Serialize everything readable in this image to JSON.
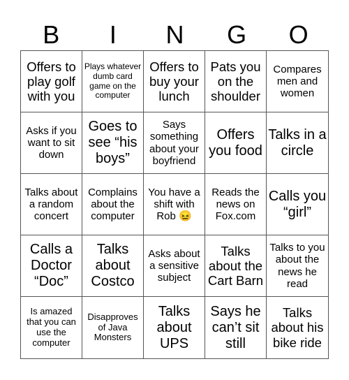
{
  "header": [
    "B",
    "I",
    "N",
    "G",
    "O"
  ],
  "cells": [
    {
      "text": "Offers to play golf with you",
      "size": "s-l"
    },
    {
      "text": "Plays whatever dumb card game on the computer",
      "size": "s-xs"
    },
    {
      "text": "Offers to buy your lunch",
      "size": "s-l"
    },
    {
      "text": "Pats you on the shoulder",
      "size": "s-l"
    },
    {
      "text": "Compares men and women",
      "size": "s-m"
    },
    {
      "text": "Asks if you want to sit down",
      "size": "s-m"
    },
    {
      "text": "Goes to see “his boys”",
      "size": "s-xl"
    },
    {
      "text": "Says something about your boyfriend",
      "size": "s-m"
    },
    {
      "text": "Offers you food",
      "size": "s-xl"
    },
    {
      "text": "Talks in a circle",
      "size": "s-xl"
    },
    {
      "text": "Talks about a random concert",
      "size": "s-m"
    },
    {
      "text": "Complains about the computer",
      "size": "s-m"
    },
    {
      "text": "You have a shift with Rob 😖",
      "size": "s-m"
    },
    {
      "text": "Reads the news on Fox.com",
      "size": "s-m"
    },
    {
      "text": "Calls you “girl”",
      "size": "s-xl"
    },
    {
      "text": "Calls a Doctor “Doc”",
      "size": "s-xl"
    },
    {
      "text": "Talks about Costco",
      "size": "s-xl"
    },
    {
      "text": "Asks about a sensitive subject",
      "size": "s-m"
    },
    {
      "text": "Talks about the Cart Barn",
      "size": "s-l"
    },
    {
      "text": "Talks to you about the news he read",
      "size": "s-m"
    },
    {
      "text": "Is amazed that you can use the computer",
      "size": "s-s"
    },
    {
      "text": "Disapproves of Java Monsters",
      "size": "s-s"
    },
    {
      "text": "Talks about UPS",
      "size": "s-xl"
    },
    {
      "text": "Says he can’t sit still",
      "size": "s-xl"
    },
    {
      "text": "Talks about his bike ride",
      "size": "s-l"
    }
  ]
}
